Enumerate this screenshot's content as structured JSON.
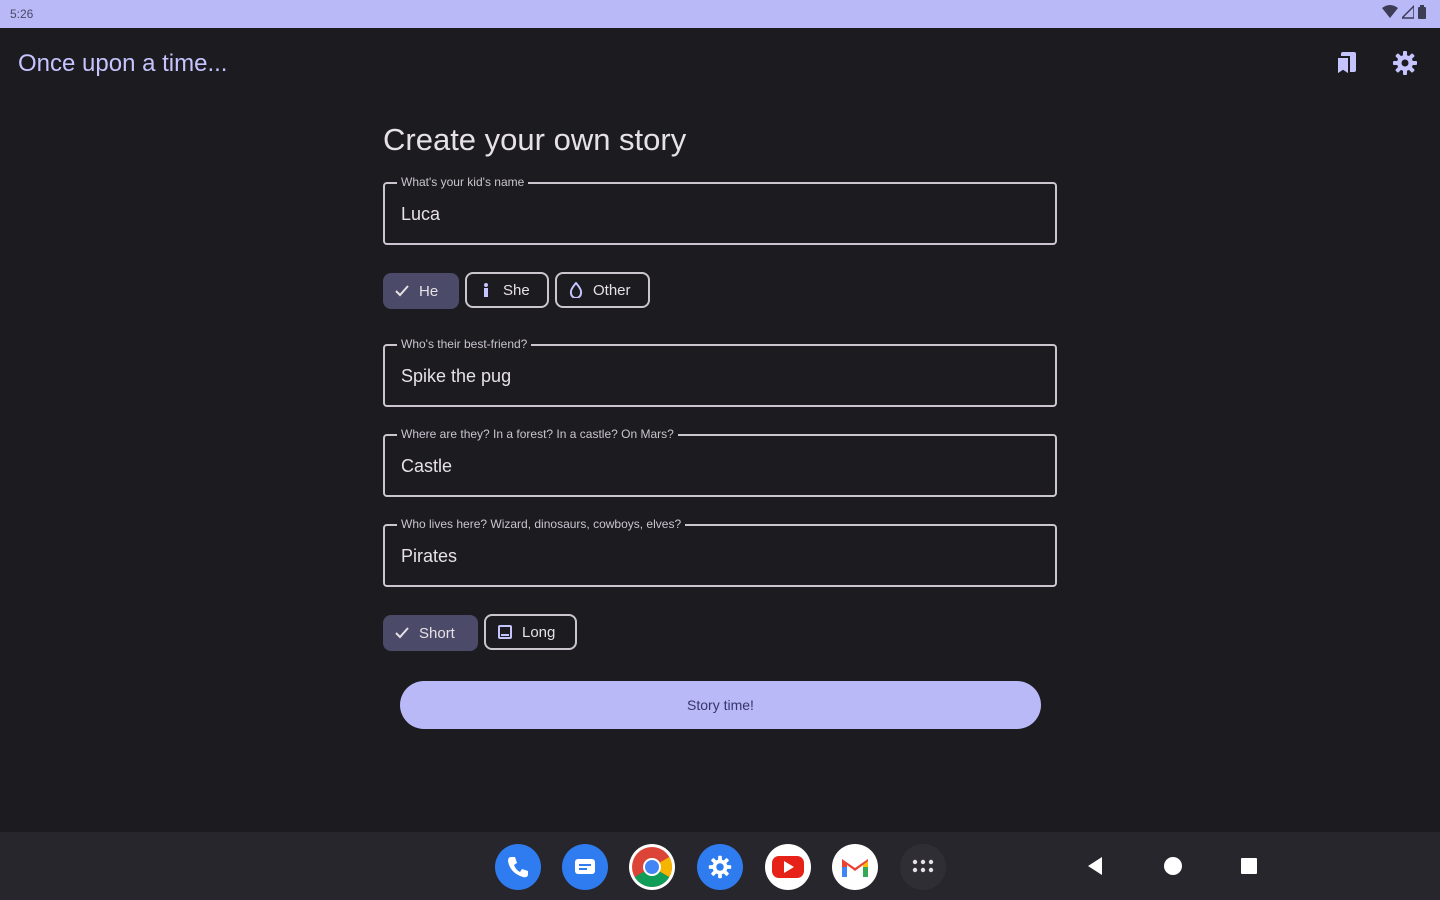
{
  "status_bar": {
    "time": "5:26"
  },
  "app": {
    "title": "Once upon a time..."
  },
  "form": {
    "heading": "Create your own story",
    "name": {
      "label": "What's your kid's name",
      "value": "Luca"
    },
    "pronouns": [
      {
        "label": "He",
        "icon": "check-icon",
        "selected": true
      },
      {
        "label": "She",
        "icon": "info-icon",
        "selected": false
      },
      {
        "label": "Other",
        "icon": "drop-icon",
        "selected": false
      }
    ],
    "best_friend": {
      "label": "Who's their best-friend?",
      "value": "Spike the pug"
    },
    "place": {
      "label": "Where are they? In a forest? In a castle? On Mars?",
      "value": "Castle"
    },
    "inhabitants": {
      "label": "Who lives here? Wizard, dinosaurs, cowboys, elves?",
      "value": "Pirates"
    },
    "length": [
      {
        "label": "Short",
        "icon": "check-icon",
        "selected": true
      },
      {
        "label": "Long",
        "icon": "book-icon",
        "selected": false
      }
    ],
    "submit_label": "Story time!"
  },
  "colors": {
    "accent": "#b9b9f7",
    "background": "#1c1b20",
    "chip_selected": "#4b4a68"
  },
  "dock": {
    "apps": [
      "phone-icon",
      "messages-icon",
      "chrome-icon",
      "settings-icon",
      "youtube-icon",
      "gmail-icon",
      "app-drawer-icon"
    ]
  }
}
